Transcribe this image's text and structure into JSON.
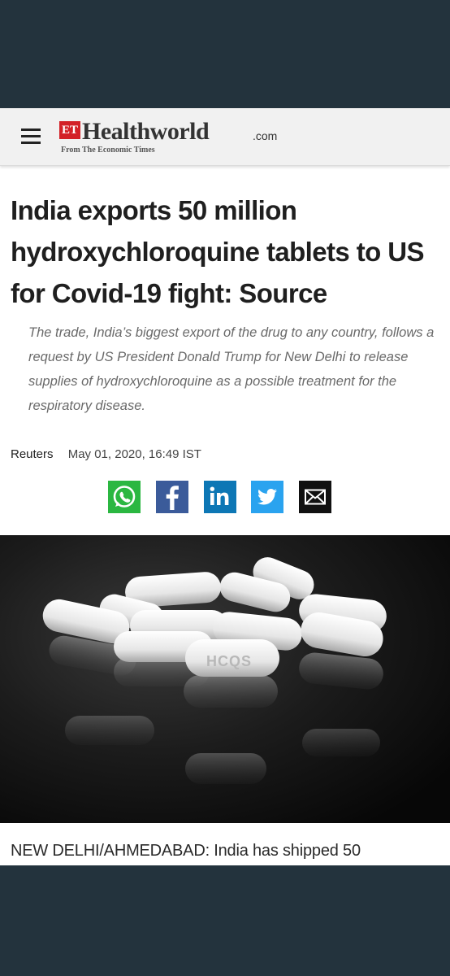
{
  "header": {
    "menu_icon": "hamburger-menu-icon",
    "logo_badge": "ET",
    "logo_name": "Healthworld",
    "logo_domain": ".com",
    "logo_tagline": "From The Economic Times"
  },
  "article": {
    "headline": "India exports 50 million hydroxychloroquine tablets to US for Covid-19 fight: Source",
    "summary": "The trade, India’s biggest export of the drug to any country, follows a request by US President Donald Trump for New Delhi to release supplies of hydroxychloroquine as a possible treatment for the respiratory disease.",
    "source": "Reuters",
    "date": "May 01, 2020, 16:49 IST",
    "image_icon": "hydroxychloroquine-tablets-photo",
    "pill_imprint": "HCQS",
    "lede": "NEW DELHI/AHMEDABAD: India has shipped 50"
  },
  "share": [
    {
      "name": "whatsapp",
      "icon": "whatsapp-icon",
      "color": "#2bb741"
    },
    {
      "name": "facebook",
      "icon": "facebook-icon",
      "color": "#3b5b9a"
    },
    {
      "name": "linkedin",
      "icon": "linkedin-icon",
      "color": "#0d77b5"
    },
    {
      "name": "twitter",
      "icon": "twitter-icon",
      "color": "#2aa3ef"
    },
    {
      "name": "email",
      "icon": "email-icon",
      "color": "#111111"
    }
  ],
  "colors": {
    "brand_red": "#d32027",
    "frame_background": "#23333d",
    "header_background": "#f1f1f1"
  }
}
